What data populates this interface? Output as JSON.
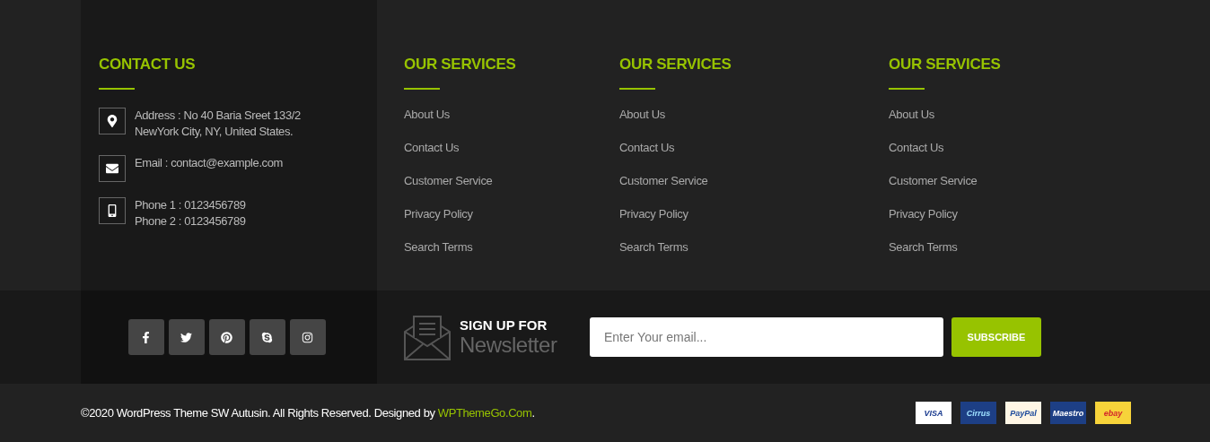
{
  "contact": {
    "title": "CONTACT US",
    "items": [
      {
        "kind": "address",
        "lines": [
          "Address : No 40 Baria Sreet 133/2",
          "NewYork City, NY, United States."
        ]
      },
      {
        "kind": "email",
        "lines": [
          "Email : contact@example.com"
        ]
      },
      {
        "kind": "phone",
        "lines": [
          "Phone 1 : 0123456789",
          "Phone 2 : 0123456789"
        ]
      }
    ]
  },
  "service_columns": [
    {
      "title": "OUR SERVICES",
      "links": [
        "About Us",
        "Contact Us",
        "Customer Service",
        "Privacy Policy",
        "Search Terms"
      ]
    },
    {
      "title": "OUR SERVICES",
      "links": [
        "About Us",
        "Contact Us",
        "Customer Service",
        "Privacy Policy",
        "Search Terms"
      ]
    },
    {
      "title": "OUR SERVICES",
      "links": [
        "About Us",
        "Contact Us",
        "Customer Service",
        "Privacy Policy",
        "Search Terms"
      ]
    }
  ],
  "social": [
    {
      "kind": "facebook"
    },
    {
      "kind": "twitter"
    },
    {
      "kind": "pinterest"
    },
    {
      "kind": "skype"
    },
    {
      "kind": "instagram"
    }
  ],
  "newsletter": {
    "title": "SIGN UP FOR",
    "subtitle": "Newsletter",
    "placeholder": "Enter Your email...",
    "button": "SUBSCRIBE"
  },
  "copyright": {
    "text": "©2020 WordPress Theme SW Autusin. All Rights Reserved. Designed by ",
    "link": "WPThemeGo.Com",
    "end": "."
  },
  "payment_cards": [
    {
      "kind": "visa",
      "label": "VISA"
    },
    {
      "kind": "cirrus",
      "label": "Cirrus"
    },
    {
      "kind": "paypal",
      "label": "PayPal"
    },
    {
      "kind": "maestro",
      "label": "Maestro"
    },
    {
      "kind": "ebay",
      "label": "ebay"
    }
  ]
}
